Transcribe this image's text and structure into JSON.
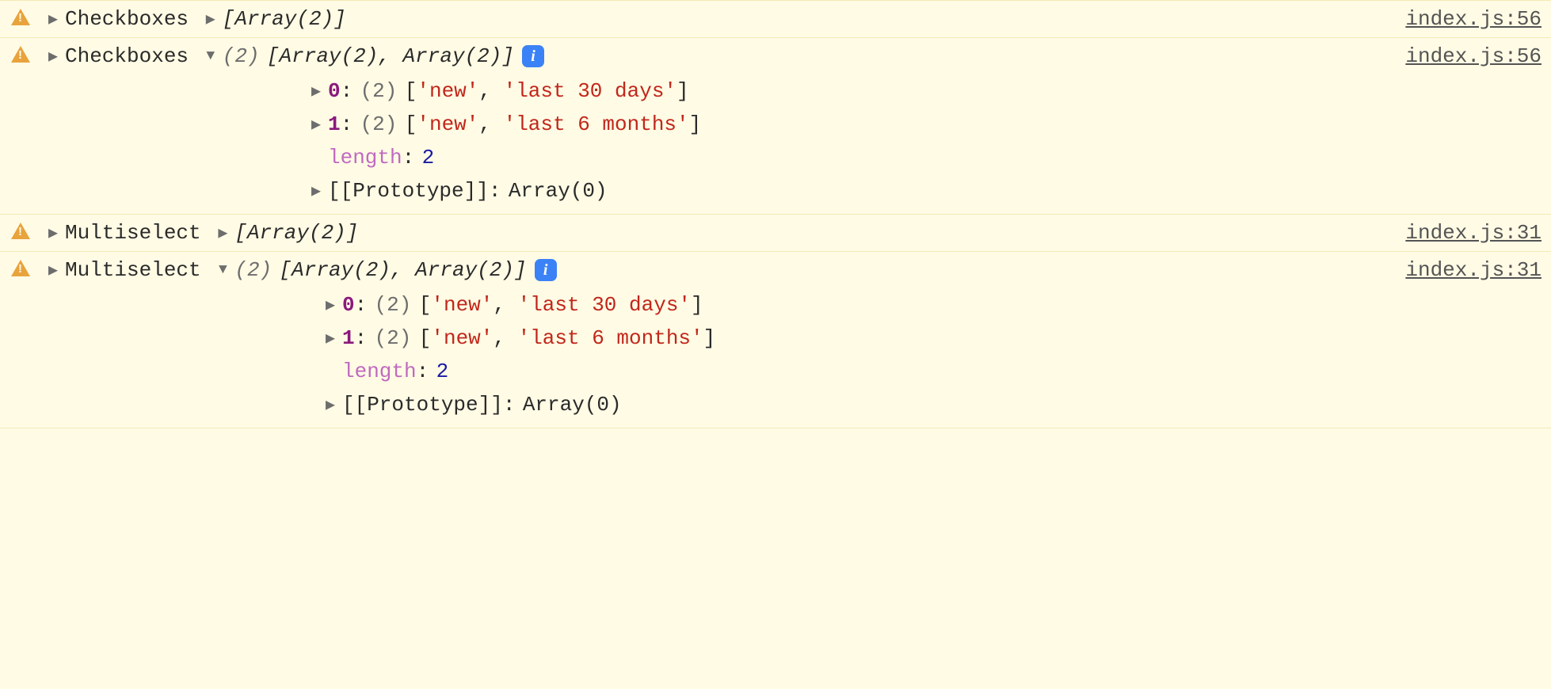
{
  "rows": [
    {
      "label": "Checkboxes",
      "collapsedSummary": "[Array(2)]",
      "expanded": false,
      "source": "index.js:56"
    },
    {
      "label": "Checkboxes",
      "expandedSummaryCount": "(2)",
      "expandedSummaryBody": "[Array(2), Array(2)]",
      "expanded": true,
      "source": "index.js:56",
      "items": [
        {
          "idx": "0",
          "count": "(2)",
          "v0": "'new'",
          "v1": "'last 30 days'"
        },
        {
          "idx": "1",
          "count": "(2)",
          "v0": "'new'",
          "v1": "'last 6 months'"
        }
      ],
      "lengthLabel": "length",
      "lengthValue": "2",
      "protoLabel": "[[Prototype]]",
      "protoValue": "Array(0)"
    },
    {
      "label": "Multiselect",
      "collapsedSummary": "[Array(2)]",
      "expanded": false,
      "source": "index.js:31"
    },
    {
      "label": "Multiselect",
      "expandedSummaryCount": "(2)",
      "expandedSummaryBody": "[Array(2), Array(2)]",
      "expanded": true,
      "source": "index.js:31",
      "items": [
        {
          "idx": "0",
          "count": "(2)",
          "v0": "'new'",
          "v1": "'last 30 days'"
        },
        {
          "idx": "1",
          "count": "(2)",
          "v0": "'new'",
          "v1": "'last 6 months'"
        }
      ],
      "lengthLabel": "length",
      "lengthValue": "2",
      "protoLabel": "[[Prototype]]",
      "protoValue": "Array(0)"
    }
  ],
  "infoGlyph": "i"
}
